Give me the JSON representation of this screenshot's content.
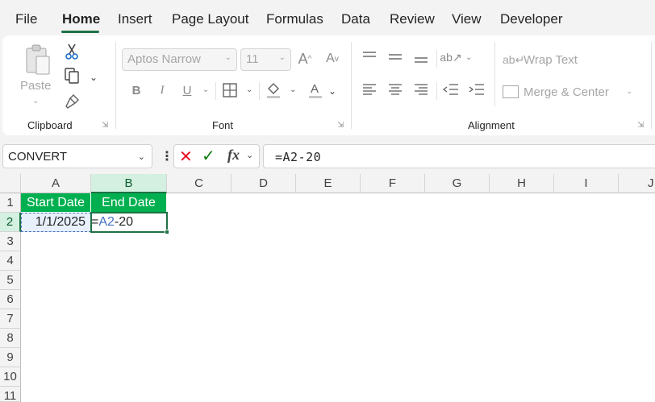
{
  "menu": {
    "tabs": [
      "File",
      "Home",
      "Insert",
      "Page Layout",
      "Formulas",
      "Data",
      "Review",
      "View",
      "Developer"
    ],
    "active_tab": "Home"
  },
  "ribbon": {
    "clipboard": {
      "label": "Clipboard",
      "paste_label": "Paste",
      "icons": [
        "paste-icon",
        "cut-icon",
        "copy-icon",
        "format-painter-icon"
      ]
    },
    "font": {
      "label": "Font",
      "font_name": "Aptos Narrow",
      "font_size": "11",
      "bold": "B",
      "italic": "I",
      "underline": "U"
    },
    "alignment": {
      "label": "Alignment",
      "wrap_text": "Wrap Text",
      "merge_center": "Merge & Center"
    }
  },
  "formula_bar": {
    "name_box": "CONVERT",
    "fx": "fx",
    "formula": "=A2-20"
  },
  "grid": {
    "columns": [
      "A",
      "B",
      "C",
      "D",
      "E",
      "F",
      "G",
      "H",
      "I",
      "J"
    ],
    "rows": [
      "1",
      "2",
      "3",
      "4",
      "5",
      "6",
      "7",
      "8",
      "9",
      "10",
      "11"
    ],
    "cells": {
      "A1": "Start Date",
      "B1": "End Date",
      "A2": "1/1/2025",
      "B2_prefix": "=",
      "B2_ref": "A2",
      "B2_suffix": "-20"
    },
    "selected_column": "B",
    "selected_row": "2"
  },
  "colors": {
    "header_fill": "#00b050",
    "accent": "#1e7145",
    "reference": "#4472c4",
    "cancel": "#e81123",
    "enter": "#107c10"
  }
}
